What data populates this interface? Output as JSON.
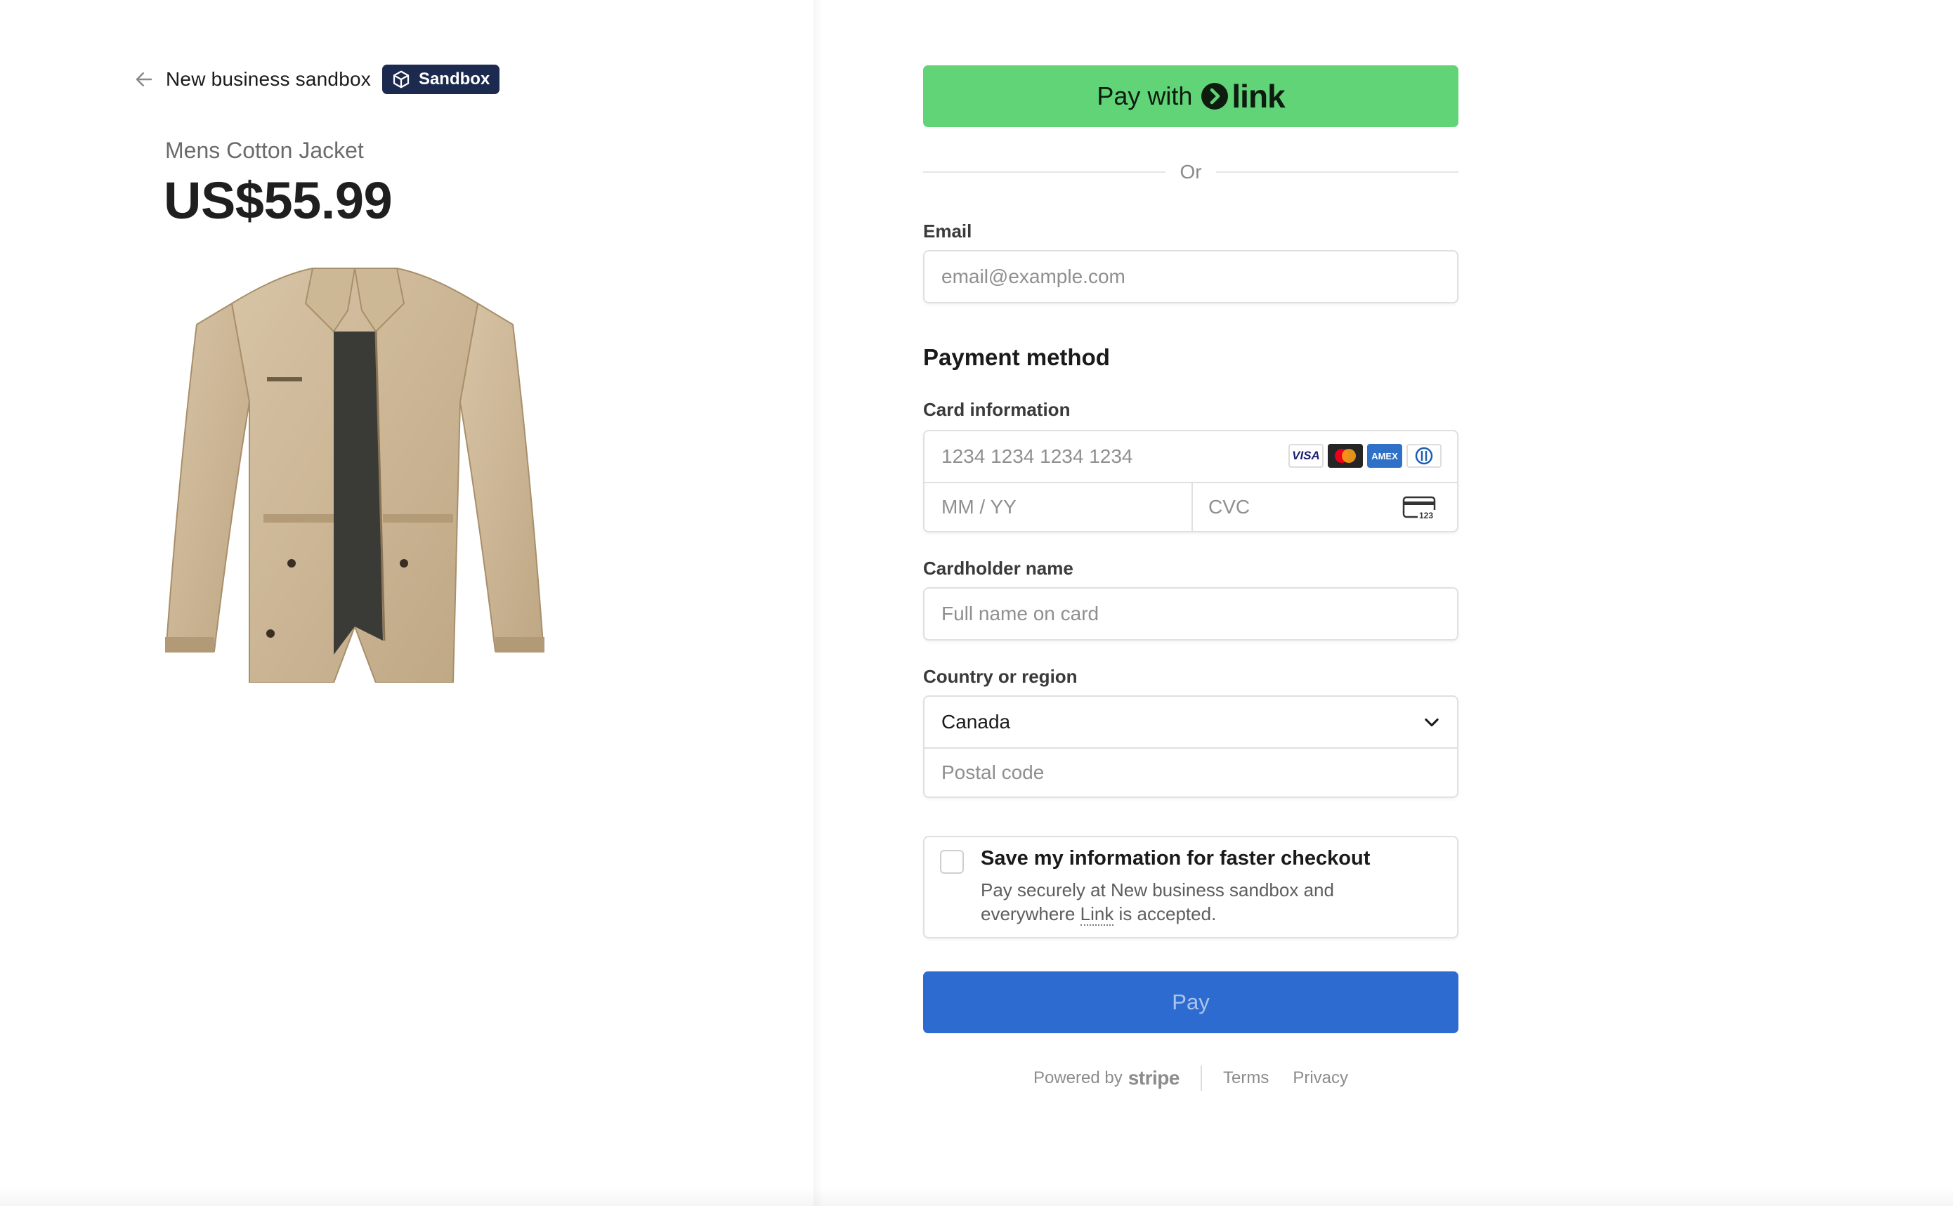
{
  "header": {
    "back_icon": "arrow-left-icon",
    "business_name": "New business sandbox",
    "badge_icon": "cube-icon",
    "badge_label": "Sandbox"
  },
  "product": {
    "name": "Mens Cotton Jacket",
    "price": "US$55.99",
    "image": "jacket-image"
  },
  "link_button": {
    "label": "Pay with",
    "logo_text": "link",
    "color": "#61d477"
  },
  "divider": {
    "label": "Or"
  },
  "email": {
    "label": "Email",
    "placeholder": "email@example.com"
  },
  "payment": {
    "section_title": "Payment method",
    "card_label": "Card information",
    "card_number_placeholder": "1234 1234 1234 1234",
    "expiry_placeholder": "MM / YY",
    "cvc_placeholder": "CVC",
    "brands": [
      {
        "name": "visa",
        "label": "VISA"
      },
      {
        "name": "mastercard",
        "label": ""
      },
      {
        "name": "amex",
        "label": "AMEX"
      },
      {
        "name": "diners",
        "label": ""
      }
    ],
    "cvc_icon_text": "123"
  },
  "cardholder": {
    "label": "Cardholder name",
    "placeholder": "Full name on card"
  },
  "country": {
    "label": "Country or region",
    "selected": "Canada",
    "postal_placeholder": "Postal code"
  },
  "save_info": {
    "title": "Save my information for faster checkout",
    "desc_before": "Pay securely at New business sandbox and everywhere ",
    "desc_link": "Link",
    "desc_after": " is accepted.",
    "checked": false
  },
  "pay_button": {
    "label": "Pay",
    "color": "#2d6bd0"
  },
  "footer": {
    "powered_by": "Powered by",
    "stripe": "stripe",
    "terms": "Terms",
    "privacy": "Privacy"
  }
}
